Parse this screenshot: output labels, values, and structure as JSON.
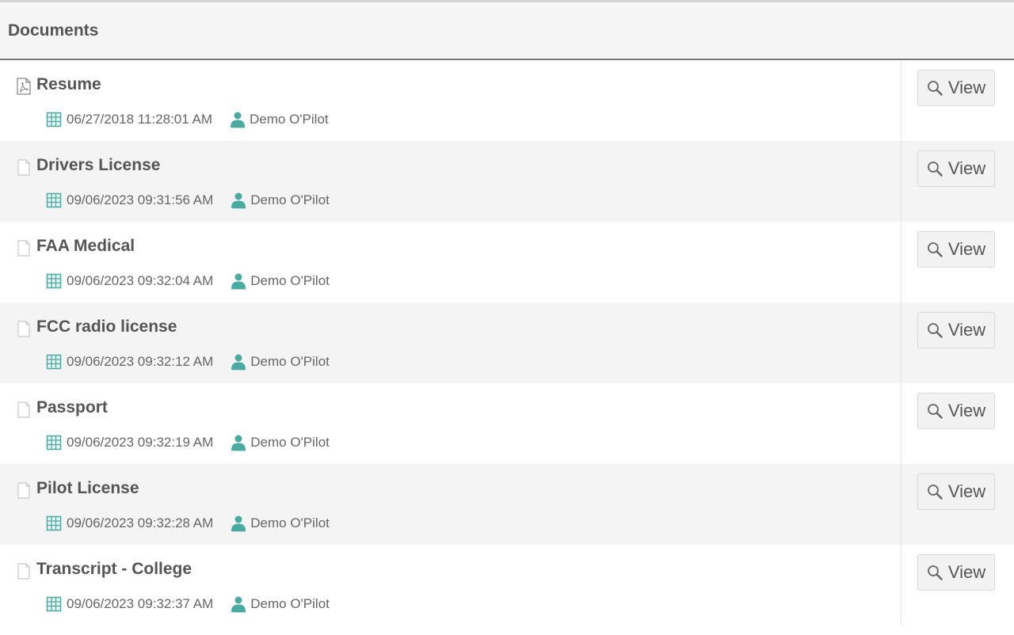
{
  "panel": {
    "title": "Documents"
  },
  "documents": [
    {
      "title": "Resume",
      "file_type": "pdf",
      "timestamp": "06/27/2018 11:28:01 AM",
      "owner": "Demo O'Pilot",
      "action_label": "View"
    },
    {
      "title": "Drivers License",
      "file_type": "generic",
      "timestamp": "09/06/2023 09:31:56 AM",
      "owner": "Demo O'Pilot",
      "action_label": "View"
    },
    {
      "title": "FAA Medical",
      "file_type": "generic",
      "timestamp": "09/06/2023 09:32:04 AM",
      "owner": "Demo O'Pilot",
      "action_label": "View"
    },
    {
      "title": "FCC radio license",
      "file_type": "generic",
      "timestamp": "09/06/2023 09:32:12 AM",
      "owner": "Demo O'Pilot",
      "action_label": "View"
    },
    {
      "title": "Passport",
      "file_type": "generic",
      "timestamp": "09/06/2023 09:32:19 AM",
      "owner": "Demo O'Pilot",
      "action_label": "View"
    },
    {
      "title": "Pilot License",
      "file_type": "generic",
      "timestamp": "09/06/2023 09:32:28 AM",
      "owner": "Demo O'Pilot",
      "action_label": "View"
    },
    {
      "title": "Transcript - College",
      "file_type": "generic",
      "timestamp": "09/06/2023 09:32:37 AM",
      "owner": "Demo O'Pilot",
      "action_label": "View"
    }
  ],
  "icons": {
    "pdf_file": "pdf-file-icon",
    "generic_file": "file-icon",
    "date": "calendar-icon",
    "owner": "user-icon",
    "view": "search-icon"
  },
  "colors": {
    "accent_teal": "#4aa9a0",
    "header_bg": "#f5f5f5",
    "stripe_bg": "#f4f4f4",
    "text": "#555555"
  }
}
